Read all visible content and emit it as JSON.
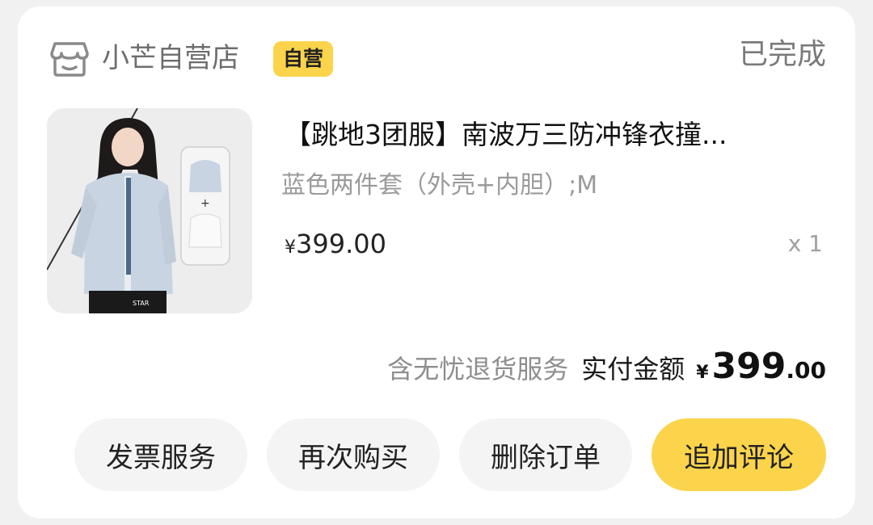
{
  "store": {
    "name": "小芒自营店",
    "badge": "自营",
    "icon": "store-icon"
  },
  "order": {
    "status": "已完成",
    "product": {
      "title": "【跳地3团服】南波万三防冲锋衣撞...",
      "variant": "蓝色两件套（外壳+内胆）;M",
      "price_currency": "¥",
      "price": "399.00",
      "quantity": "x 1",
      "image_text": "STAR"
    },
    "summary": {
      "service": "含无忧退货服务",
      "paid_label": "实付金额",
      "paid_currency": "¥",
      "paid_integer": "399",
      "paid_decimal": ".00"
    },
    "actions": {
      "invoice": "发票服务",
      "rebuy": "再次购买",
      "delete": "删除订单",
      "review": "追加评论"
    }
  },
  "colors": {
    "accent": "#fbd44b",
    "background": "#f1f1f1",
    "card": "#ffffff"
  }
}
